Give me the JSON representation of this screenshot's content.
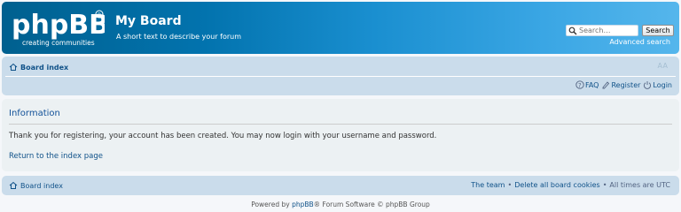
{
  "header": {
    "logo_main": "phpBB",
    "logo_sub": "creating communities",
    "site_title": "My Board",
    "site_description": "A short text to describe your forum",
    "search_placeholder": "Search…",
    "search_button": "Search",
    "advanced_search": "Advanced search"
  },
  "navbar": {
    "breadcrumb": "Board index",
    "font_size_control": "A A",
    "links": {
      "faq": "FAQ",
      "register": "Register",
      "login": "Login"
    }
  },
  "panel": {
    "title": "Information",
    "message": "Thank you for registering, your account has been created. You may now login with your username and password.",
    "return_link": "Return to the index page"
  },
  "footer": {
    "breadcrumb": "Board index",
    "team": "The team",
    "separator": "•",
    "delete_cookies": "Delete all board cookies",
    "timezone": "All times are UTC"
  },
  "copyright": {
    "prefix": "Powered by",
    "brand": "phpBB",
    "middle": "® Forum Software © phpBB Group"
  },
  "colors": {
    "header_start": "#00608f",
    "header_end": "#55b6ec",
    "nav_bg": "#cadceb",
    "panel_bg": "#ecf1f3",
    "link": "#105289"
  },
  "icons": [
    "home-icon",
    "faq-icon",
    "register-icon",
    "login-icon",
    "search-icon"
  ]
}
